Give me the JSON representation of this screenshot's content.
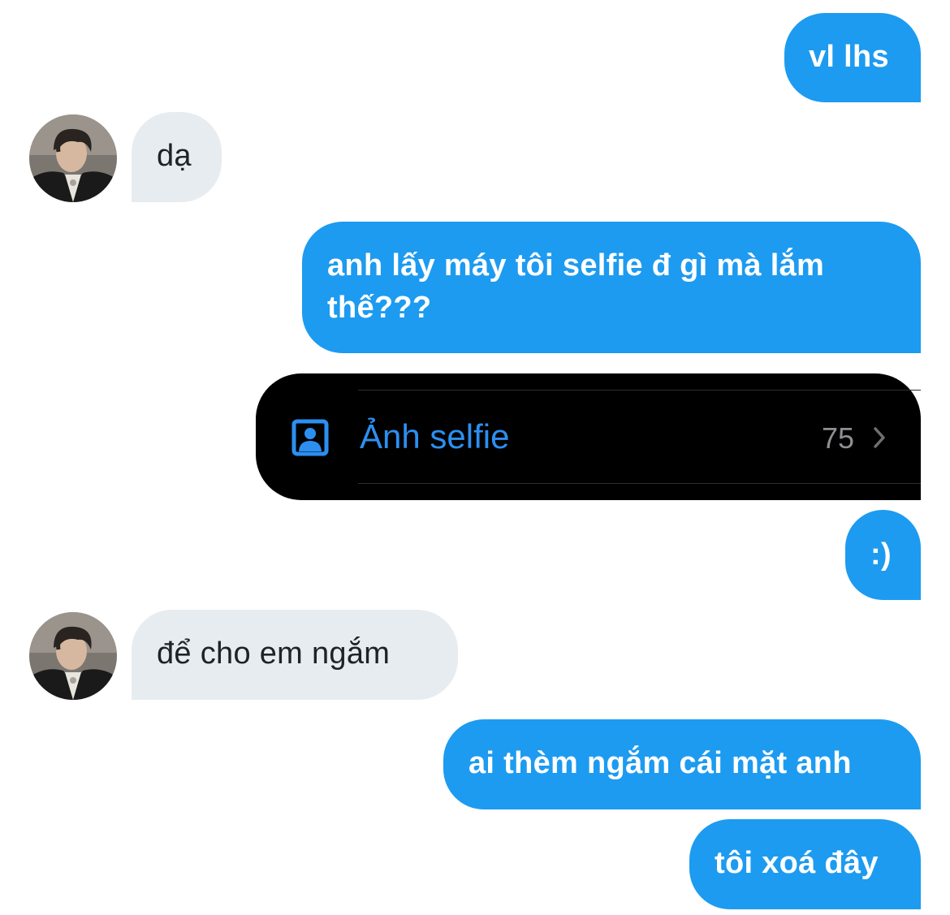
{
  "colors": {
    "outgoing_bubble": "#1d9bf0",
    "incoming_bubble": "#e7ecf0",
    "card_background": "#000000",
    "card_accent": "#2c8ff0"
  },
  "messages": [
    {
      "direction": "out",
      "text": "vl lhs"
    },
    {
      "direction": "in",
      "text": "dạ"
    },
    {
      "direction": "out",
      "text": "anh lấy máy tôi selfie đ gì mà lắm thế???"
    },
    {
      "direction": "out",
      "type": "album-card",
      "icon": "person-portrait-icon",
      "label": "Ảnh selfie",
      "count": "75",
      "chevron": "chevron-right-icon"
    },
    {
      "direction": "out",
      "text": ":)"
    },
    {
      "direction": "in",
      "text": "để cho em ngắm"
    },
    {
      "direction": "out",
      "text": "ai thèm ngắm cái mặt anh"
    },
    {
      "direction": "out",
      "text": "tôi xoá đây"
    }
  ],
  "avatar": {
    "icon": "contact-avatar"
  }
}
